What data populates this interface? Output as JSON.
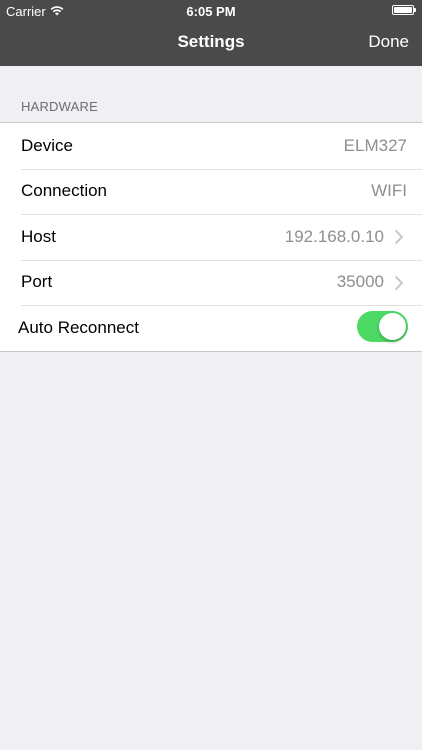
{
  "status_bar": {
    "carrier": "Carrier",
    "time": "6:05 PM",
    "wifi_icon": "wifi-icon",
    "battery_icon": "battery-icon"
  },
  "nav": {
    "title": "Settings",
    "done_label": "Done"
  },
  "section": {
    "header": "HARDWARE"
  },
  "rows": [
    {
      "label": "Device",
      "value": "ELM327"
    },
    {
      "label": "Connection",
      "value": "WIFI"
    },
    {
      "label": "Host",
      "value": "192.168.0.10",
      "chevron": "chevron-right-icon"
    },
    {
      "label": "Port",
      "value": "35000",
      "chevron": "chevron-right-icon"
    }
  ],
  "auto_reconnect": {
    "label": "Auto Reconnect",
    "on": true
  },
  "colors": {
    "nav_bar": "#4a4a4a",
    "background": "#efeff4",
    "toggle_on": "#4cd964",
    "secondary_text": "#8e8e93"
  }
}
